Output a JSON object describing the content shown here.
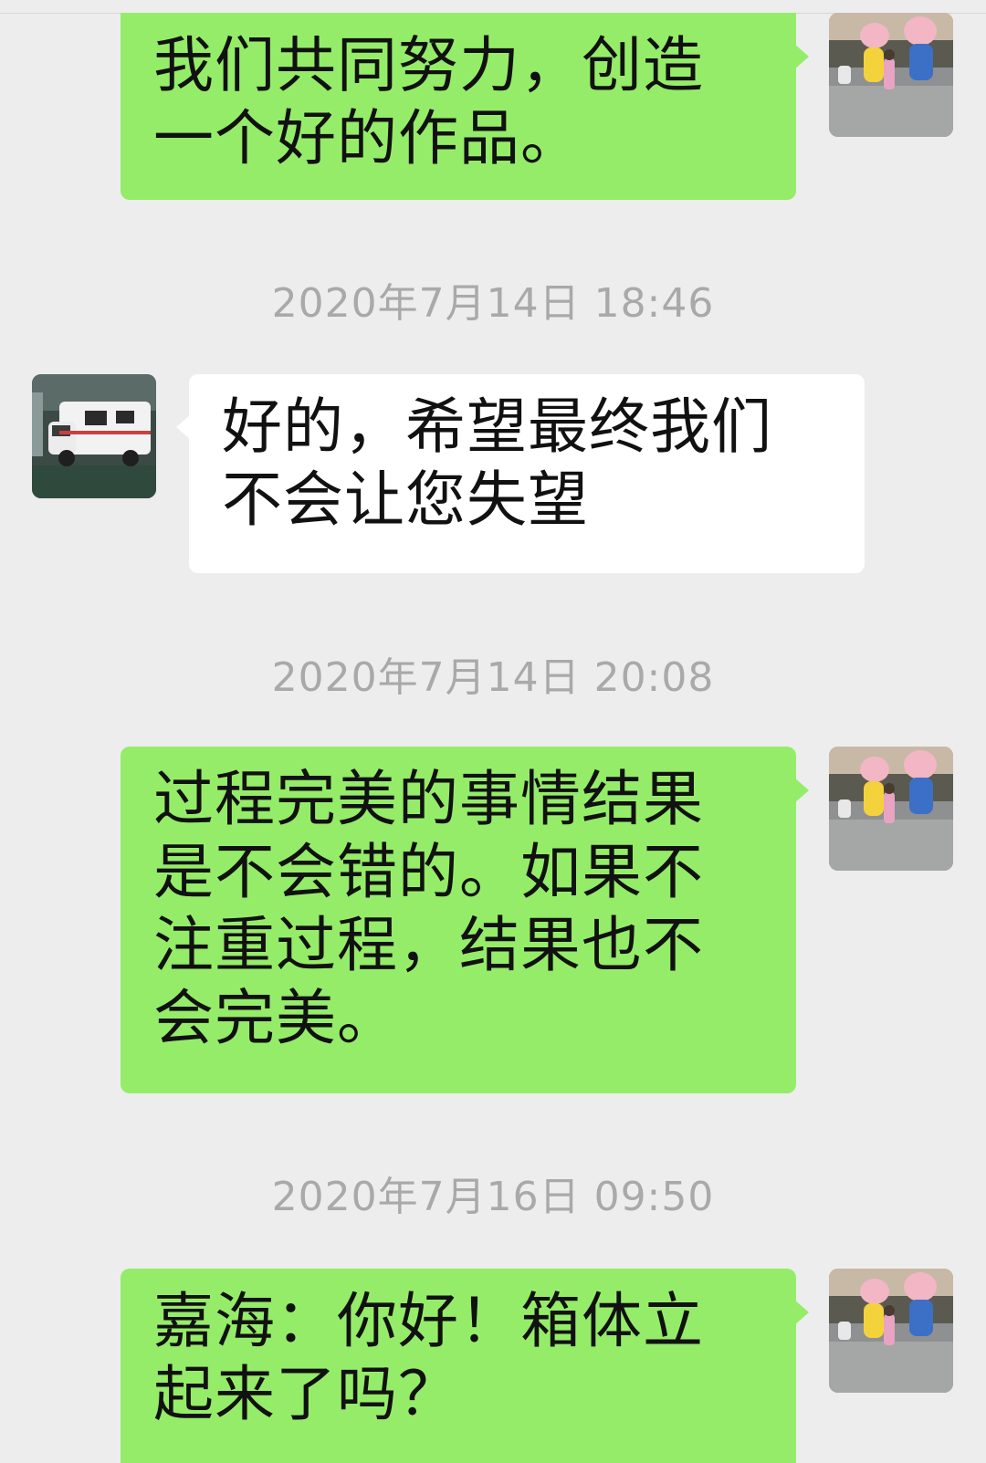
{
  "messages": [
    {
      "sender": "me",
      "text": "我们共同努力，创造一个好的作品。"
    },
    {
      "sender": "other",
      "text": "好的，希望最终我们不会让您失望"
    },
    {
      "sender": "me",
      "text": "过程完美的事情结果是不会错的。如果不注重过程，结果也不会完美。"
    },
    {
      "sender": "me",
      "text": "嘉海：你好！箱体立起来了吗？"
    }
  ],
  "timestamps": [
    "2020年7月14日 18:46",
    "2020年7月14日 20:08",
    "2020年7月16日 09:50"
  ],
  "avatars": {
    "me": "avatar-cartoon-statues-child-icon",
    "other": "avatar-rv-van-icon"
  },
  "colors": {
    "background": "#ededed",
    "my_bubble": "#95ec69",
    "other_bubble": "#ffffff",
    "timestamp_text": "#a9a9a9",
    "message_text": "#111111"
  }
}
